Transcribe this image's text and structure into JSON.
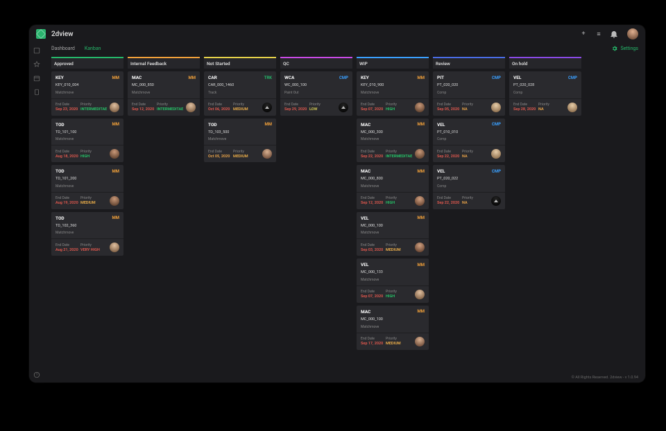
{
  "brand": "2dview",
  "titlebar": {
    "plus": "+",
    "menu": "≡",
    "bell": "●"
  },
  "tabs": {
    "dashboard": "Dashboard",
    "kanban": "Kanban",
    "settings": "Settings"
  },
  "footer": "© All Rights Reserved. 2dview - v 1.0.94",
  "labels": {
    "endDate": "End Date",
    "priority": "Priority"
  },
  "columns": [
    {
      "name": "Approved",
      "cards": [
        {
          "title": "KEY",
          "tag": "MM",
          "code": "KEY_010_004",
          "task": "Matchmove",
          "end": "Sep 23, 2020",
          "endCls": "date-red",
          "pri": "INTERMEDITAE",
          "priCls": "pri-INTERMEDITAE",
          "av": "av-1"
        },
        {
          "title": "TOD",
          "tag": "MM",
          "code": "TD_101_100",
          "task": "Matchmove",
          "end": "Aug 18, 2020",
          "endCls": "date-red",
          "pri": "HIGH",
          "priCls": "pri-HIGH",
          "av": "av-2"
        },
        {
          "title": "TOD",
          "tag": "MM",
          "code": "TD_101_200",
          "task": "Matchmove",
          "end": "Aug 19, 2020",
          "endCls": "date-red",
          "pri": "MEDIUM",
          "priCls": "pri-MEDIUM",
          "av": "av-2"
        },
        {
          "title": "TOD",
          "tag": "MM",
          "code": "TD_102_360",
          "task": "Matchmove",
          "end": "Aug 21, 2020",
          "endCls": "date-red",
          "pri": "VERY HIGH",
          "priCls": "pri-VERYHIGH",
          "av": "av-1"
        }
      ]
    },
    {
      "name": "Internal Feedback",
      "cards": [
        {
          "title": "MAC",
          "tag": "MM",
          "code": "MC_000_850",
          "task": "Matchmove",
          "end": "Sep 12, 2020",
          "endCls": "date-red",
          "pri": "INTERMEDITAE",
          "priCls": "pri-INTERMEDITAE",
          "av": "av-1"
        }
      ]
    },
    {
      "name": "Not Started",
      "cards": [
        {
          "title": "CAR",
          "tag": "TRK",
          "code": "CAR_000_1460",
          "task": "Track",
          "end": "Oct 06, 2020",
          "endCls": "date-red",
          "pri": "MEDIUM",
          "priCls": "pri-MEDIUM",
          "av": "av-3"
        },
        {
          "title": "TOD",
          "tag": "MM",
          "code": "TD_103_500",
          "task": "Matchmove",
          "end": "Oct 05, 2020",
          "endCls": "date-orange",
          "pri": "MEDIUM",
          "priCls": "pri-MEDIUM",
          "av": "av-4"
        }
      ]
    },
    {
      "name": "QC",
      "cards": [
        {
          "title": "WCA",
          "tag": "CMP",
          "code": "WC_000_100",
          "task": "Paint Out",
          "end": "Sep 29, 2020",
          "endCls": "date-red",
          "pri": "LOW",
          "priCls": "pri-LOW",
          "av": "av-3"
        }
      ]
    },
    {
      "name": "WIP",
      "cards": [
        {
          "title": "KEY",
          "tag": "MM",
          "code": "KEY_010_900",
          "task": "Matchmove",
          "end": "Sep 07, 2020",
          "endCls": "date-red",
          "pri": "HIGH",
          "priCls": "pri-HIGH",
          "av": "av-2"
        },
        {
          "title": "MAC",
          "tag": "MM",
          "code": "MC_000_300",
          "task": "Matchmove",
          "end": "Sep 22, 2020",
          "endCls": "date-red",
          "pri": "INTERMEDITAE",
          "priCls": "pri-INTERMEDITAE",
          "av": "av-2"
        },
        {
          "title": "MAC",
          "tag": "MM",
          "code": "MC_000_800",
          "task": "Matchmove",
          "end": "Sep 12, 2020",
          "endCls": "date-red",
          "pri": "HIGH",
          "priCls": "pri-HIGH",
          "av": "av-6"
        },
        {
          "title": "VEL",
          "tag": "MM",
          "code": "MC_000_100",
          "task": "Matchmove",
          "end": "Sep 03, 2020",
          "endCls": "date-red",
          "pri": "MEDIUM",
          "priCls": "pri-MEDIUM",
          "av": "av-6"
        },
        {
          "title": "VEL",
          "tag": "MM",
          "code": "MC_000_133",
          "task": "Matchmove",
          "end": "Sep 07, 2020",
          "endCls": "date-red",
          "pri": "HIGH",
          "priCls": "pri-HIGH",
          "av": "av-1"
        },
        {
          "title": "MAC",
          "tag": "MM",
          "code": "MC_000_100",
          "task": "Matchmove",
          "end": "Sep 17, 2020",
          "endCls": "date-red",
          "pri": "MEDIUM",
          "priCls": "pri-MEDIUM",
          "av": "av-4"
        }
      ]
    },
    {
      "name": "Review",
      "cards": [
        {
          "title": "PIT",
          "tag": "CMP",
          "code": "PT_020_020",
          "task": "Comp",
          "end": "Sep 05, 2020",
          "endCls": "date-red",
          "pri": "NA",
          "priCls": "pri-NA",
          "av": "av-5"
        },
        {
          "title": "VEL",
          "tag": "CMP",
          "code": "PT_010_010",
          "task": "Comp",
          "end": "Sep 22, 2020",
          "endCls": "date-red",
          "pri": "NA",
          "priCls": "pri-NA",
          "av": "av-5"
        },
        {
          "title": "VEL",
          "tag": "CMP",
          "code": "PT_020_022",
          "task": "Comp",
          "end": "Sep 22, 2020",
          "endCls": "date-red",
          "pri": "NA",
          "priCls": "pri-NA",
          "av": "av-3"
        }
      ]
    },
    {
      "name": "On hold",
      "cards": [
        {
          "title": "VEL",
          "tag": "CMP",
          "code": "PT_020_028",
          "task": "Comp",
          "end": "Sep 28, 2020",
          "endCls": "date-red",
          "pri": "NA",
          "priCls": "pri-NA",
          "av": "av-5"
        }
      ]
    }
  ]
}
